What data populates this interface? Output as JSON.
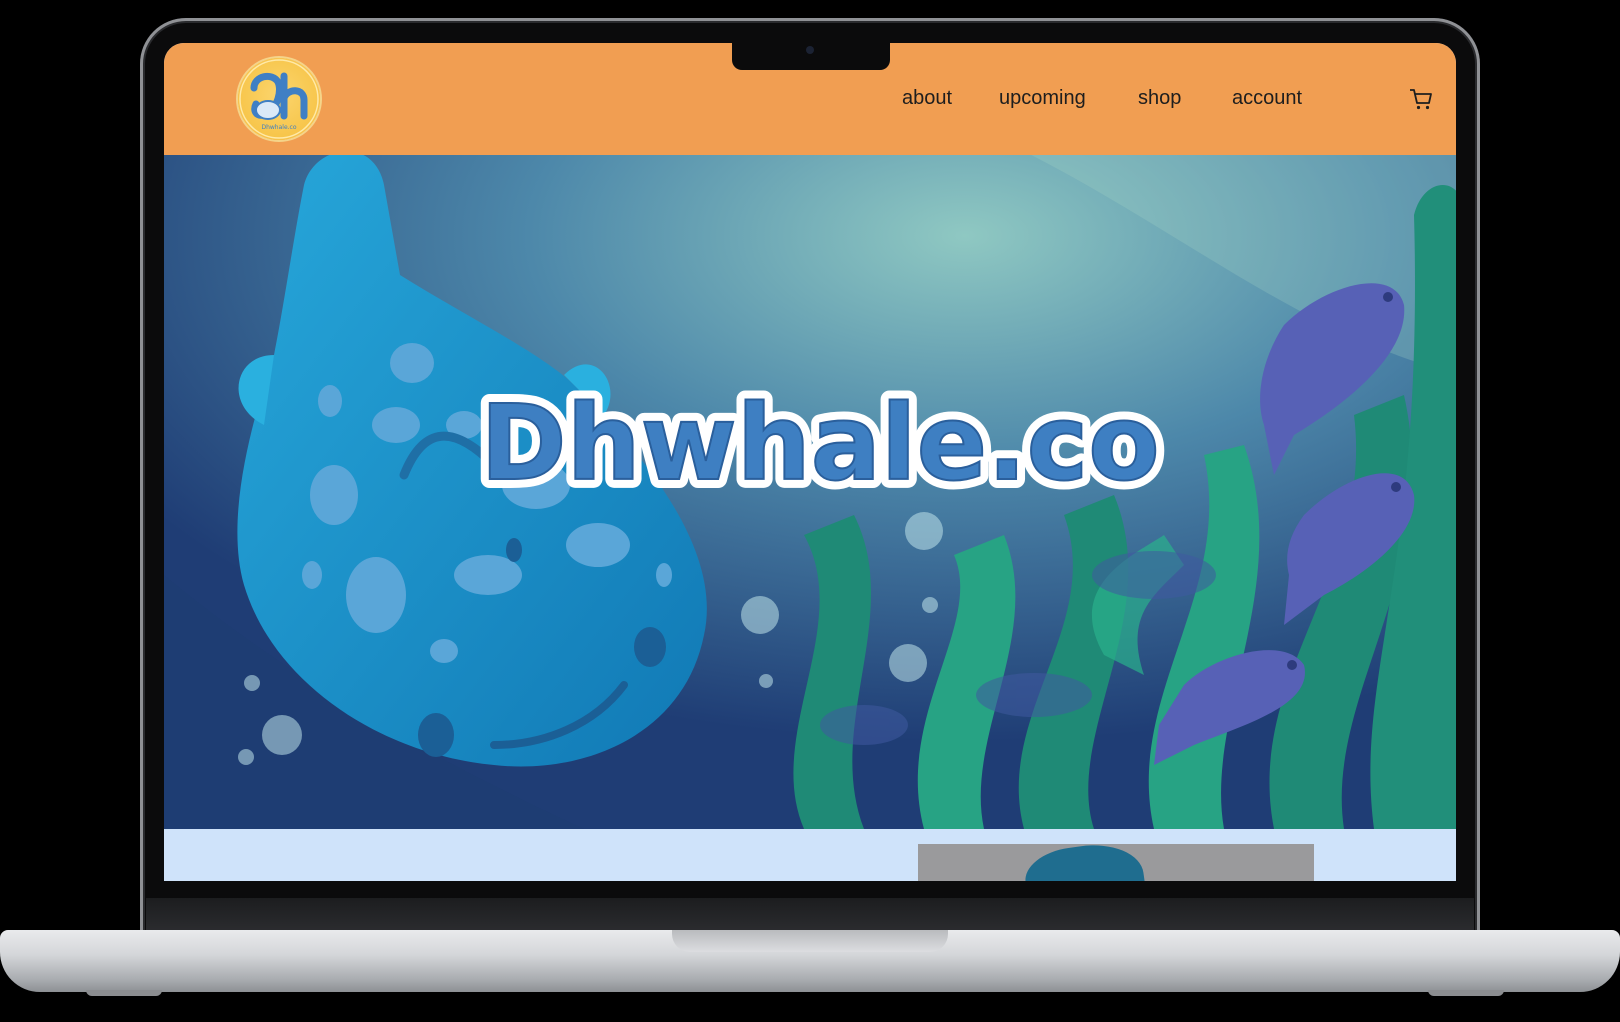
{
  "header": {
    "logo_text": "Dh",
    "nav": [
      {
        "label": "about"
      },
      {
        "label": "upcoming"
      },
      {
        "label": "shop"
      },
      {
        "label": "account"
      }
    ],
    "cart_icon": "cart-icon"
  },
  "hero": {
    "title": "Dhwhale.co"
  },
  "content": {
    "teaser_text": "",
    "preview_image": "product-preview"
  },
  "colors": {
    "header_bg": "#f19e52",
    "content_bg": "#cfe3fa",
    "nav_text": "#1e1e1e"
  }
}
